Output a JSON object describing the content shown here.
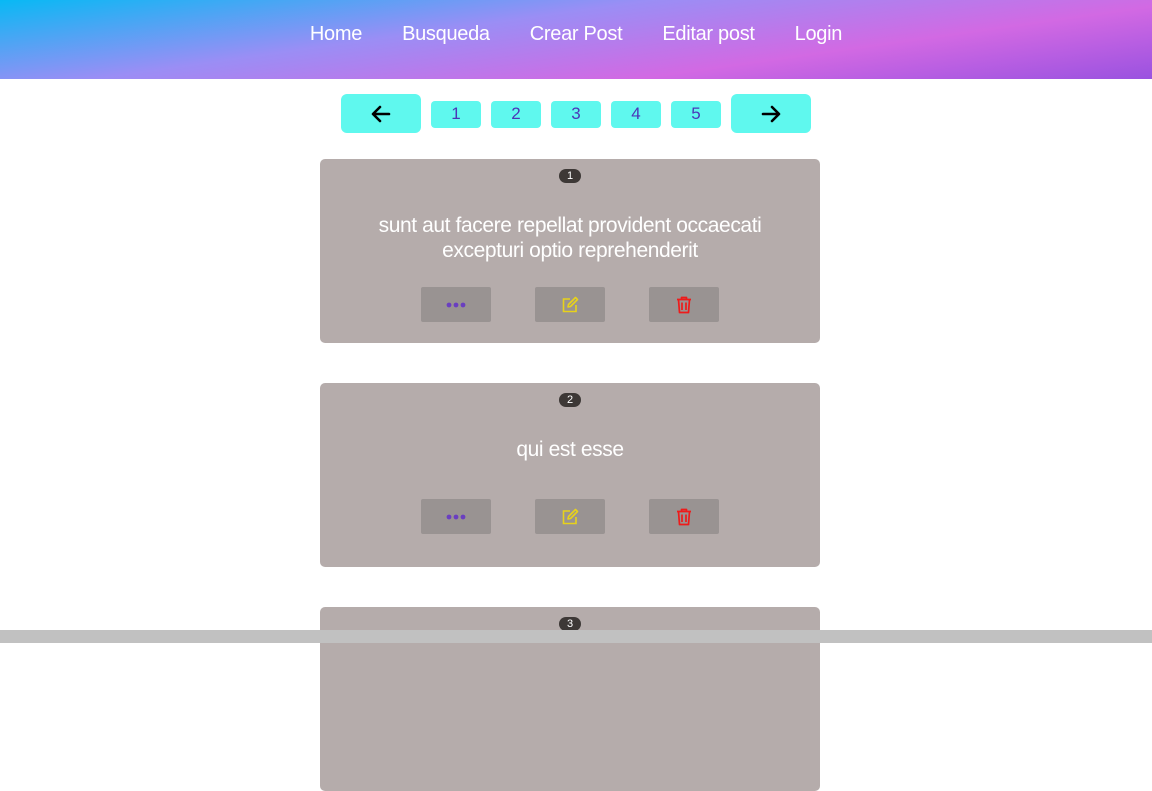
{
  "nav": {
    "items": [
      "Home",
      "Busqueda",
      "Crear Post",
      "Editar post",
      "Login"
    ]
  },
  "pagination": {
    "prev_icon": "arrow-left-icon",
    "next_icon": "arrow-right-icon",
    "pages": [
      "1",
      "2",
      "3",
      "4",
      "5"
    ]
  },
  "posts": [
    {
      "id": "1",
      "title": "sunt aut facere repellat provident occaecati excepturi optio reprehenderit"
    },
    {
      "id": "2",
      "title": "qui est esse"
    },
    {
      "id": "3",
      "title": ""
    }
  ],
  "actions": {
    "more_icon": "ellipsis-icon",
    "edit_icon": "edit-icon",
    "delete_icon": "trash-icon"
  },
  "colors": {
    "accent_button": "#5ff8ee",
    "more_color": "#6a3fc0",
    "edit_color": "#e8d21a",
    "delete_color": "#ee1b1b",
    "card_bg": "#b5acab"
  }
}
